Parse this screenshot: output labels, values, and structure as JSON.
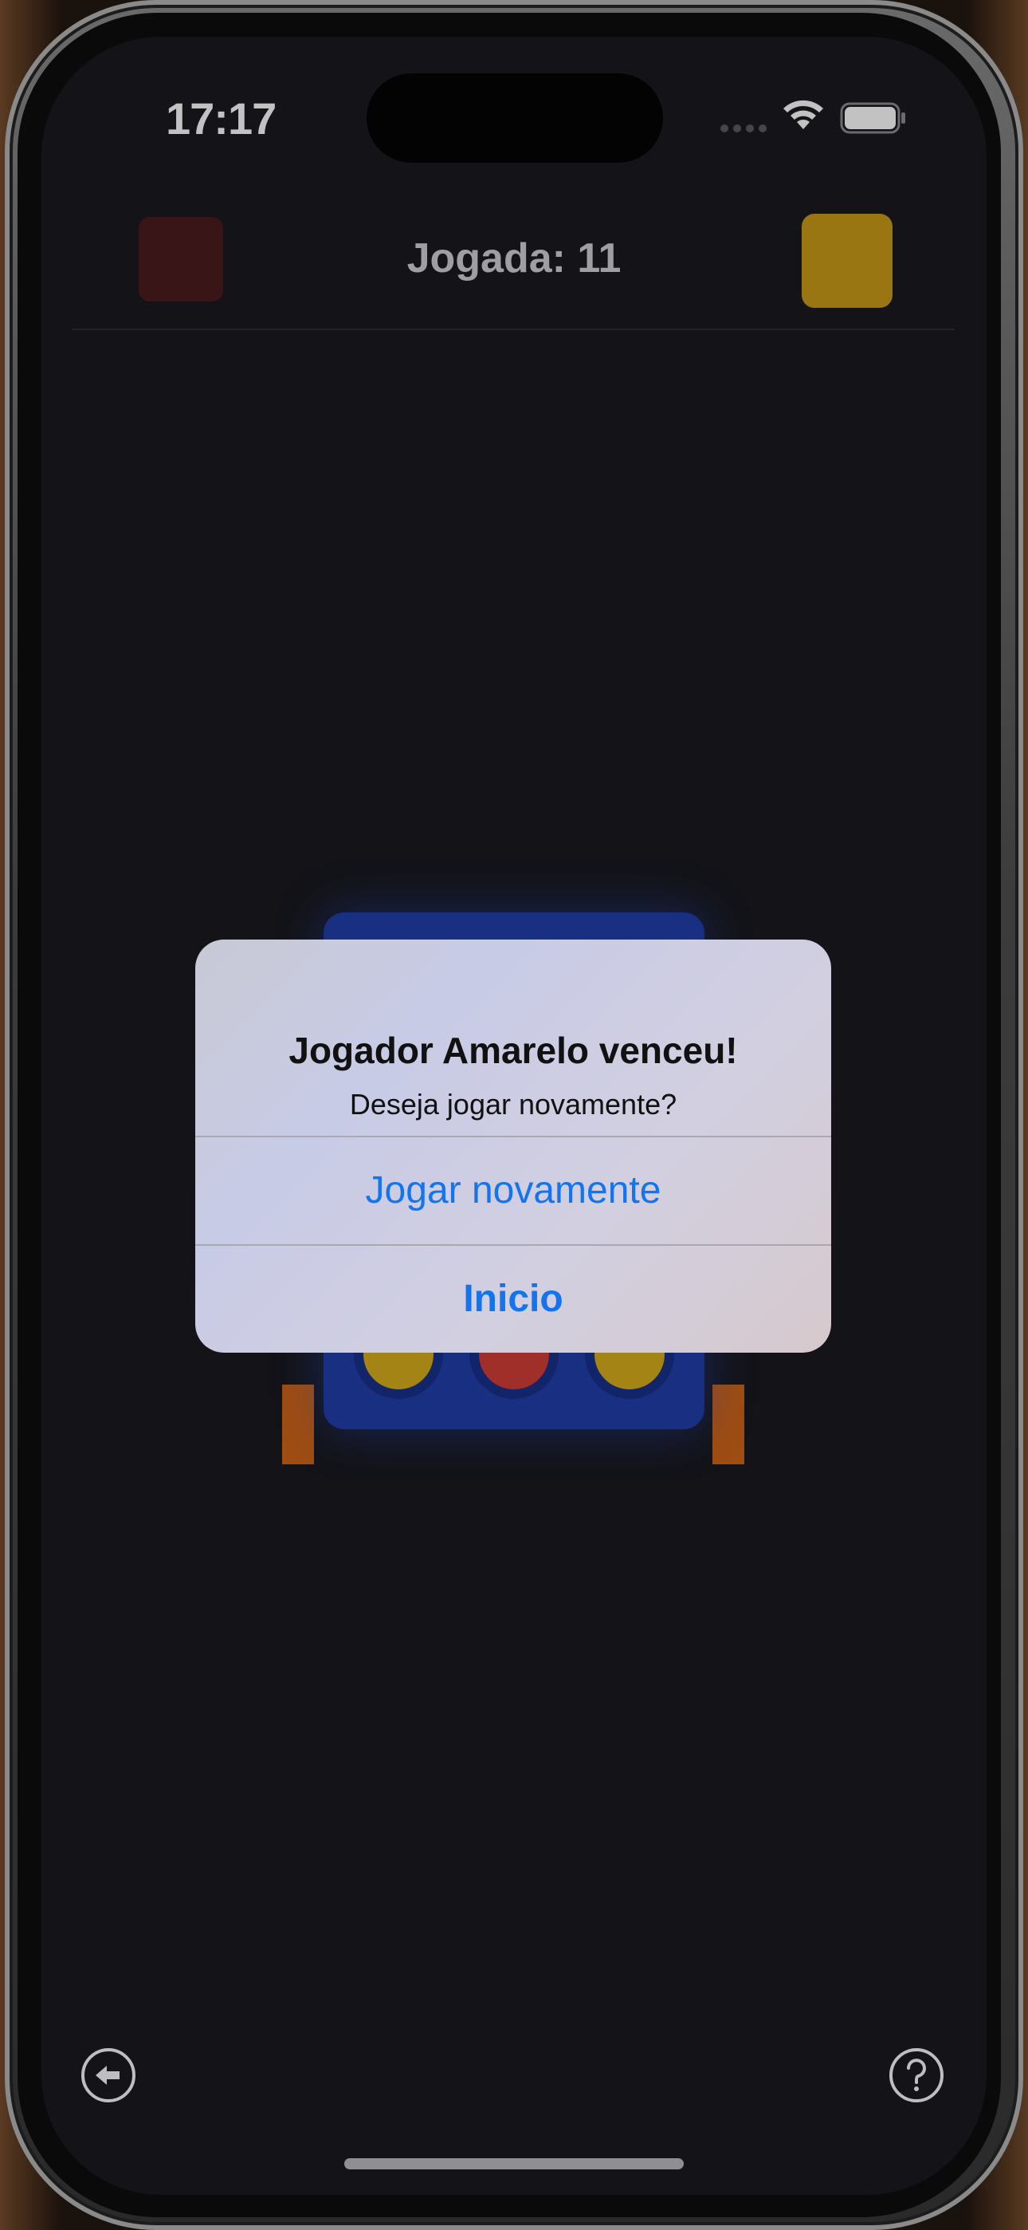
{
  "status_bar": {
    "time": "17:17",
    "wifi_icon": "wifi-icon",
    "battery_icon": "battery-icon"
  },
  "header": {
    "turn_label": "Jogada: 11",
    "player_red_color": "#4a191b",
    "player_yellow_color": "#c89a12"
  },
  "board": {
    "color": "#1c3ba8",
    "legs_color": "#d06312",
    "visible_bottom_row": [
      "yellow",
      "red",
      "yellow"
    ]
  },
  "alert": {
    "title": "Jogador Amarelo venceu!",
    "message": "Deseja jogar novamente?",
    "buttons": [
      {
        "label": "Jogar novamente"
      },
      {
        "label": "Inicio"
      }
    ],
    "button_color": "#1474ee"
  },
  "footer": {
    "back_icon": "back-arrow-icon",
    "help_icon": "help-icon"
  }
}
